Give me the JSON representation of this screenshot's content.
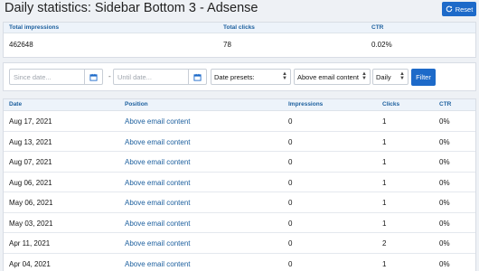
{
  "header": {
    "title": "Daily statistics: Sidebar Bottom 3 - Adsense",
    "reset_label": "Reset"
  },
  "stats": {
    "columns": [
      "Total impressions",
      "Total clicks",
      "CTR"
    ],
    "values": [
      "462648",
      "78",
      "0.02%"
    ]
  },
  "filters": {
    "since_placeholder": "Since date...",
    "until_placeholder": "Until date...",
    "separator": "-",
    "date_presets": "Date presets:",
    "position": "Above email content",
    "grouping": "Daily",
    "filter_label": "Filter"
  },
  "table": {
    "columns": [
      "Date",
      "Position",
      "Impressions",
      "Clicks",
      "CTR"
    ],
    "rows": [
      {
        "date": "Aug 17, 2021",
        "position": "Above email content",
        "impressions": "0",
        "clicks": "1",
        "ctr": "0%"
      },
      {
        "date": "Aug 13, 2021",
        "position": "Above email content",
        "impressions": "0",
        "clicks": "1",
        "ctr": "0%"
      },
      {
        "date": "Aug 07, 2021",
        "position": "Above email content",
        "impressions": "0",
        "clicks": "1",
        "ctr": "0%"
      },
      {
        "date": "Aug 06, 2021",
        "position": "Above email content",
        "impressions": "0",
        "clicks": "1",
        "ctr": "0%"
      },
      {
        "date": "May 06, 2021",
        "position": "Above email content",
        "impressions": "0",
        "clicks": "1",
        "ctr": "0%"
      },
      {
        "date": "May 03, 2021",
        "position": "Above email content",
        "impressions": "0",
        "clicks": "1",
        "ctr": "0%"
      },
      {
        "date": "Apr 11, 2021",
        "position": "Above email content",
        "impressions": "0",
        "clicks": "2",
        "ctr": "0%"
      },
      {
        "date": "Apr 04, 2021",
        "position": "Above email content",
        "impressions": "0",
        "clicks": "1",
        "ctr": "0%"
      }
    ]
  },
  "colors": {
    "accent": "#1d6ac9",
    "header_text": "#1c5f9e",
    "header_bg": "#edf3fa",
    "page_bg": "#eef1f5"
  }
}
